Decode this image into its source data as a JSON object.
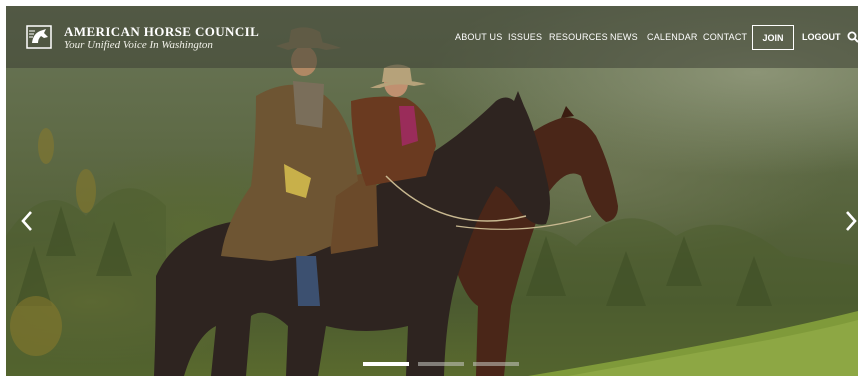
{
  "brand": {
    "name": "AMERICAN HORSE COUNCIL",
    "tagline": "Your Unified Voice In Washington",
    "logo_icon": "horse-head-icon"
  },
  "nav": {
    "items": [
      {
        "label": "ABOUT US"
      },
      {
        "label": "ISSUES"
      },
      {
        "label": "RESOURCES"
      },
      {
        "label": "NEWS"
      },
      {
        "label": "CALENDAR"
      },
      {
        "label": "CONTACT"
      }
    ],
    "join_label": "JOIN",
    "logout_label": "LOGOUT",
    "search_icon": "search-icon"
  },
  "hero": {
    "image_subject": "two cowboys riding horses on a misty forested hillside",
    "prev_icon": "chevron-left-icon",
    "next_icon": "chevron-right-icon",
    "slides_total": 3,
    "active_slide": 1
  },
  "colors": {
    "header_overlay": "#3e4234",
    "text": "#ffffff"
  }
}
